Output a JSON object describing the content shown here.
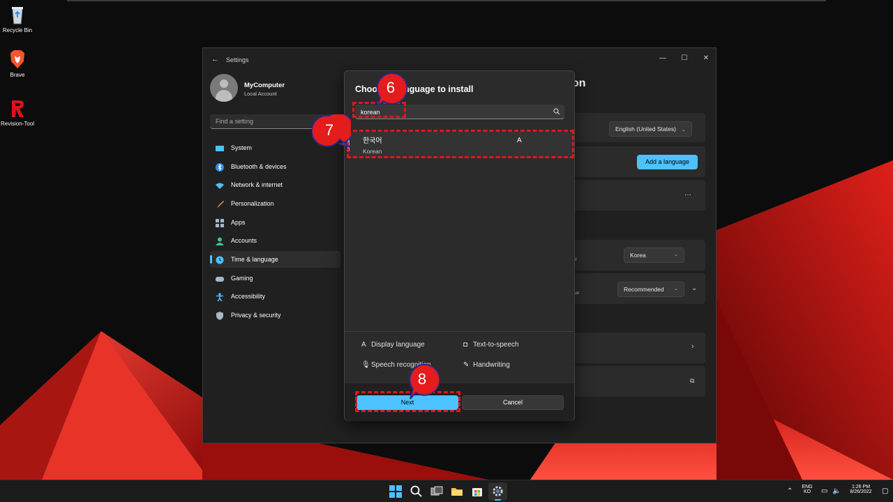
{
  "desktop": {
    "icons": [
      {
        "label": "Recycle Bin"
      },
      {
        "label": "Brave"
      },
      {
        "label": "Revision-Tool"
      }
    ]
  },
  "settings": {
    "title": "Settings",
    "user": {
      "name": "MyComputer",
      "account": "Local Account"
    },
    "search_placeholder": "Find a setting",
    "nav": [
      {
        "label": "System",
        "color": "#4cc2ff"
      },
      {
        "label": "Bluetooth & devices",
        "color": "#2f8ee8"
      },
      {
        "label": "Network & internet",
        "color": "#4cc2ff"
      },
      {
        "label": "Personalization",
        "color": "#e0a060"
      },
      {
        "label": "Apps",
        "color": "#a7b7c7"
      },
      {
        "label": "Accounts",
        "color": "#3cc58a"
      },
      {
        "label": "Time & language",
        "color": "#4cc2ff"
      },
      {
        "label": "Gaming",
        "color": "#a7b7c7"
      },
      {
        "label": "Accessibility",
        "color": "#4cc2ff"
      },
      {
        "label": "Privacy & security",
        "color": "#a7b7c7"
      }
    ],
    "active_nav": "Time & language",
    "page_title_tail": "on",
    "display_language_value": "English (United States)",
    "add_language_label": "Add a language",
    "more_label": "···",
    "region_value": "Korea",
    "region_tiny": "at",
    "format_value": "Recommended",
    "format_tiny": "nat"
  },
  "dialog": {
    "title": "Choose a language to install",
    "search_value": "korean",
    "result": {
      "native": "한국어",
      "english": "Korean",
      "feature_glyph": "A"
    },
    "features": [
      {
        "label": "Display language",
        "glyph": "A"
      },
      {
        "label": "Text-to-speech",
        "glyph": "◘"
      },
      {
        "label": "Speech recognition",
        "glyph": "🎙"
      },
      {
        "label": "Handwriting",
        "glyph": "✎"
      }
    ],
    "next_label": "Next",
    "cancel_label": "Cancel"
  },
  "annotations": [
    {
      "number": "6"
    },
    {
      "number": "7"
    },
    {
      "number": "8"
    }
  ],
  "taskbar": {
    "lang_top": "ENG",
    "lang_bottom": "KO",
    "time": "1:26 PM",
    "date": "8/26/2022"
  },
  "colors": {
    "accent": "#4cc2ff",
    "annotation": "#e0161c"
  }
}
